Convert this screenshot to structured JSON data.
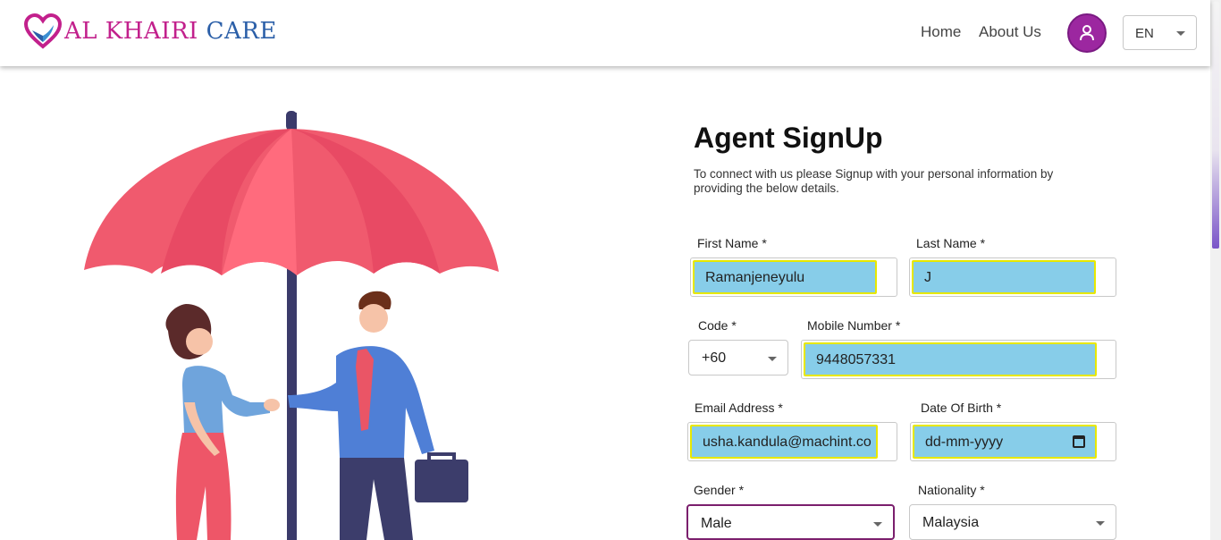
{
  "header": {
    "logo_text_primary": "AL KHAIRI",
    "logo_text_secondary": "CARE",
    "nav": {
      "home": "Home",
      "about": "About Us"
    },
    "language": "EN"
  },
  "form": {
    "title": "Agent SignUp",
    "subtitle": "To connect with us please Signup with your personal information by providing the below details.",
    "first_name": {
      "label": "First Name *",
      "value": "Ramanjeneyulu"
    },
    "last_name": {
      "label": "Last Name *",
      "value": "J"
    },
    "code": {
      "label": "Code *",
      "value": "+60"
    },
    "mobile": {
      "label": "Mobile Number *",
      "value": "9448057331"
    },
    "email": {
      "label": "Email Address *",
      "value": "usha.kandula@machint.co"
    },
    "dob": {
      "label": "Date Of Birth *",
      "value": "dd-mm-yyyy"
    },
    "gender": {
      "label": "Gender *",
      "value": "Male"
    },
    "nationality": {
      "label": "Nationality *",
      "value": "Malaysia"
    }
  },
  "colors": {
    "brand_magenta": "#c2208c",
    "brand_blue": "#2b5fa8",
    "avatar_purple": "#9c27a0",
    "autofill_blue": "#87cde9",
    "umbrella_red": "#f05a6e"
  }
}
